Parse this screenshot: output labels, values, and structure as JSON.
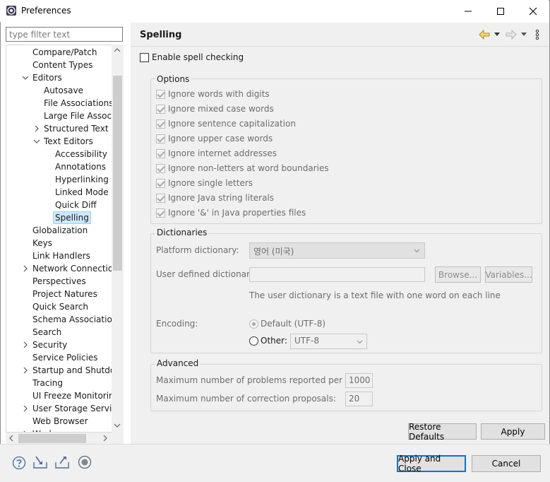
{
  "window": {
    "title": "Preferences",
    "minimize_icon": "minimize-icon",
    "maximize_icon": "maximize-icon",
    "close_icon": "close-icon"
  },
  "filter": {
    "placeholder": "type filter text"
  },
  "tree": {
    "items": [
      {
        "label": "Compare/Patch",
        "level": 1
      },
      {
        "label": "Content Types",
        "level": 1
      },
      {
        "label": "Editors",
        "level": 1,
        "expanded": true
      },
      {
        "label": "Autosave",
        "level": 2
      },
      {
        "label": "File Associations",
        "level": 2
      },
      {
        "label": "Large File Associati",
        "level": 2
      },
      {
        "label": "Structured Text Ed",
        "level": 2,
        "collapsed": true
      },
      {
        "label": "Text Editors",
        "level": 2,
        "expanded": true
      },
      {
        "label": "Accessibility",
        "level": 3
      },
      {
        "label": "Annotations",
        "level": 3
      },
      {
        "label": "Hyperlinking",
        "level": 3
      },
      {
        "label": "Linked Mode",
        "level": 3
      },
      {
        "label": "Quick Diff",
        "level": 3
      },
      {
        "label": "Spelling",
        "level": 3,
        "selected": true
      },
      {
        "label": "Globalization",
        "level": 1
      },
      {
        "label": "Keys",
        "level": 1
      },
      {
        "label": "Link Handlers",
        "level": 1
      },
      {
        "label": "Network Connection",
        "level": 1,
        "collapsed": true
      },
      {
        "label": "Perspectives",
        "level": 1
      },
      {
        "label": "Project Natures",
        "level": 1
      },
      {
        "label": "Quick Search",
        "level": 1
      },
      {
        "label": "Schema Associations",
        "level": 1
      },
      {
        "label": "Search",
        "level": 1
      },
      {
        "label": "Security",
        "level": 1,
        "collapsed": true
      },
      {
        "label": "Service Policies",
        "level": 1
      },
      {
        "label": "Startup and Shutdow",
        "level": 1,
        "collapsed": true
      },
      {
        "label": "Tracing",
        "level": 1
      },
      {
        "label": "UI Freeze Monitoring",
        "level": 1
      },
      {
        "label": "User Storage Service",
        "level": 1,
        "collapsed": true
      },
      {
        "label": "Web Browser",
        "level": 1
      },
      {
        "label": "Workspace",
        "level": 1,
        "collapsed": true
      }
    ]
  },
  "page": {
    "title": "Spelling",
    "enable_spell_checking": "Enable spell checking",
    "options": {
      "label": "Options",
      "items": [
        "Ignore words with digits",
        "Ignore mixed case words",
        "Ignore sentence capitalization",
        "Ignore upper case words",
        "Ignore internet addresses",
        "Ignore non-letters at word boundaries",
        "Ignore single letters",
        "Ignore Java string literals",
        "Ignore '&' in Java properties files"
      ]
    },
    "dictionaries": {
      "label": "Dictionaries",
      "platform_dictionary_label": "Platform dictionary:",
      "platform_dictionary_value": "영어 (미국)",
      "user_dictionary_label": "User defined dictionary:",
      "browse_label": "Browse...",
      "variables_label": "Variables...",
      "user_dictionary_note": "The user dictionary is a text file with one word on each line",
      "encoding_label": "Encoding:",
      "default_encoding": "Default (UTF-8)",
      "other_label": "Other:",
      "other_value": "UTF-8"
    },
    "advanced": {
      "label": "Advanced",
      "max_problems_label": "Maximum number of problems reported per file:",
      "max_problems_value": "1000",
      "max_proposals_label": "Maximum number of correction proposals:",
      "max_proposals_value": "20"
    },
    "restore_defaults": "Restore Defaults",
    "apply": "Apply"
  },
  "footer": {
    "apply_and_close": "Apply and Close",
    "cancel": "Cancel"
  },
  "colors": {
    "selection": "#cce8ff",
    "accent": "#0078d7",
    "panel": "#f0f0f0"
  }
}
